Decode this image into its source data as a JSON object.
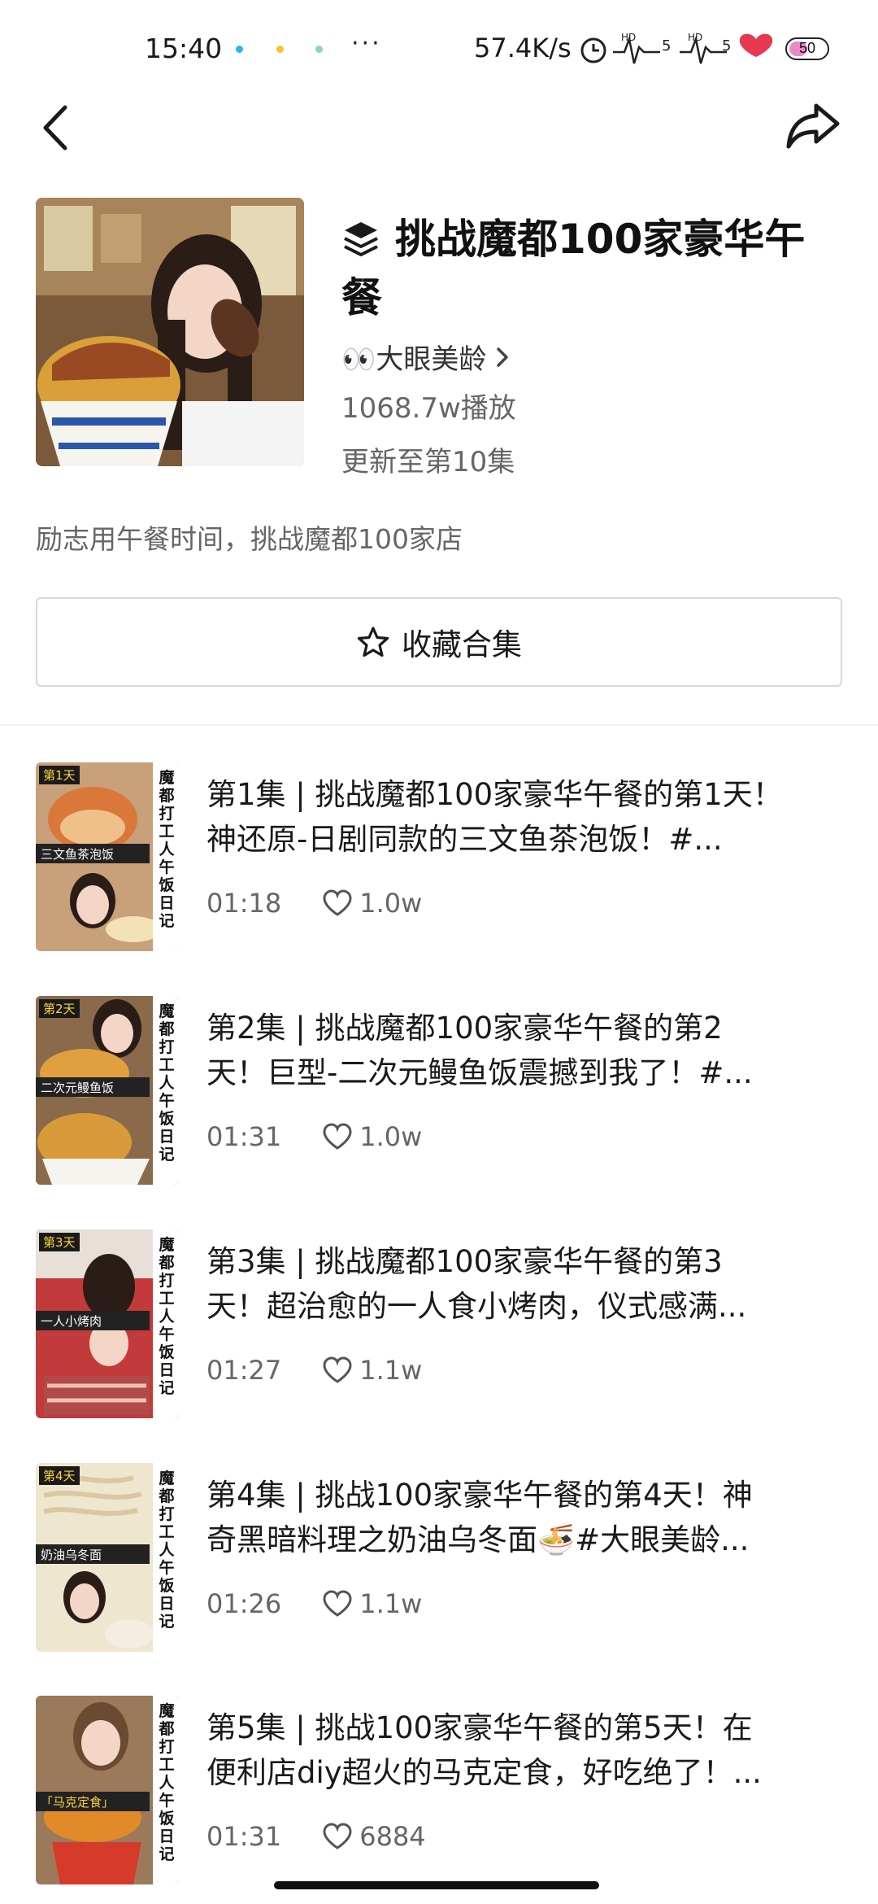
{
  "status_bar": {
    "time": "15:40",
    "more": "···",
    "net_speed": "57.4K/s",
    "battery": "50",
    "battery_level": 0.5
  },
  "collection": {
    "title": "挑战魔都100家豪华午餐",
    "author": "👀大眼美龄",
    "plays": "1068.7w播放",
    "update": "更新至第10集",
    "description": "励志用午餐时间，挑战魔都100家店",
    "favorite_label": "收藏合集"
  },
  "episodes": [
    {
      "line1": "第1集 | 挑战魔都100家豪华午餐的第1天！",
      "line2": "神还原-日剧同款的三文鱼茶泡饭！#...",
      "duration": "01:18",
      "likes": "1.0w",
      "badge": "第1天",
      "caption": "三文鱼茶泡饭",
      "side": "魔都打工人午饭日记"
    },
    {
      "line1": "第2集 | 挑战魔都100家豪华午餐的第2",
      "line2": "天！巨型-二次元鳗鱼饭震撼到我了！#...",
      "duration": "01:31",
      "likes": "1.0w",
      "badge": "第2天",
      "caption": "二次元鳗鱼饭",
      "side": "魔都打工人午饭日记"
    },
    {
      "line1": "第3集 | 挑战魔都100家豪华午餐的第3",
      "line2": "天！超治愈的一人食小烤肉，仪式感满...",
      "duration": "01:27",
      "likes": "1.1w",
      "badge": "第3天",
      "caption": "一人小烤肉",
      "side": "魔都打工人午饭日记"
    },
    {
      "line1": "第4集 | 挑战100家豪华午餐的第4天！神",
      "line2": "奇黑暗料理之奶油乌冬面🍜#大眼美龄...",
      "duration": "01:26",
      "likes": "1.1w",
      "badge": "第4天",
      "caption": "奶油乌冬面",
      "side": "魔都打工人午饭日记"
    },
    {
      "line1": "第5集 | 挑战100家豪华午餐的第5天！在",
      "line2": "便利店diy超火的马克定食，好吃绝了！...",
      "duration": "01:31",
      "likes": "6884",
      "badge": "",
      "caption": "「马克定食」",
      "side": "魔都打工人午饭日记"
    }
  ],
  "colors": {
    "badge_bg": "#1a1a1a",
    "badge_text": "#ffd23a",
    "caption_bg": "#222",
    "side_bg": "#ffffff"
  }
}
